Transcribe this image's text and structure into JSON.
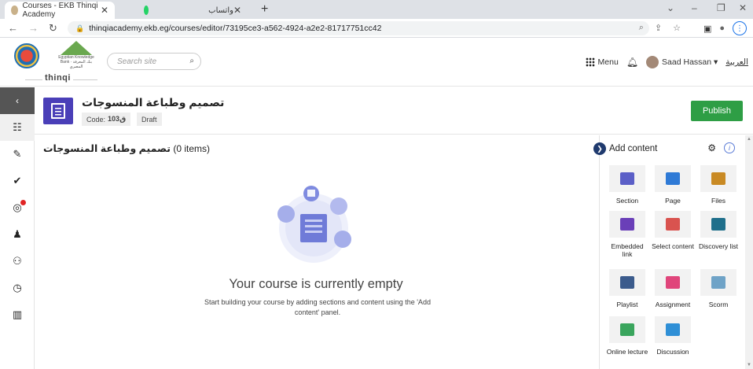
{
  "browser": {
    "tabs": [
      {
        "title": "Courses - EKB Thinqi Academy",
        "active": true
      },
      {
        "title": "واتساب",
        "active": false
      }
    ],
    "new_tab": "+",
    "url": "thinqiacademy.ekb.eg/courses/editor/73195ce3-a562-4924-a2e2-81717751cc42",
    "controls": {
      "minimize": "–",
      "restore": "❐",
      "close": "✕",
      "menu": "⌄"
    },
    "profile_initial": "⋮"
  },
  "header": {
    "search_placeholder": "Search site",
    "brand_small": "thinqi",
    "menu_label": "Menu",
    "user_name": "Saad Hassan",
    "user_caret": "▾",
    "language_link": "العربية",
    "ekb_caption": "Egyptian Knowledge Bank · بنك المعرفة المصري"
  },
  "sidebar": {
    "collapse": "‹",
    "items": [
      {
        "name": "course-outline",
        "glyph": "☷"
      },
      {
        "name": "edit",
        "glyph": "✎"
      },
      {
        "name": "assessments",
        "glyph": "✔"
      },
      {
        "name": "goals",
        "glyph": "◎"
      },
      {
        "name": "learners",
        "glyph": "♟"
      },
      {
        "name": "groups",
        "glyph": "⚇"
      },
      {
        "name": "history",
        "glyph": "◷"
      },
      {
        "name": "reports",
        "glyph": "▥"
      }
    ]
  },
  "course": {
    "title": "تصميم وطباعة المنسوجات",
    "code_label": "Code:",
    "code_value": "ق103",
    "status": "Draft",
    "publish_label": "Publish"
  },
  "main": {
    "section_title": "تصميم وطباعة المنسوجات",
    "item_count": "(0 items)",
    "empty_title": "Your course is currently empty",
    "empty_desc": "Start building your course by adding sections and content using the 'Add content' panel."
  },
  "add_content": {
    "title": "Add content",
    "info": "i",
    "tiles": [
      {
        "label": "Section",
        "icon": "section-icon",
        "color": "#5b5fc7"
      },
      {
        "label": "Page",
        "icon": "page-icon",
        "color": "#2f7ad6"
      },
      {
        "label": "Files",
        "icon": "files-icon",
        "color": "#c98a24"
      },
      {
        "label": "Embedded link",
        "icon": "link-icon",
        "color": "#6a3fb8"
      },
      {
        "label": "Select content",
        "icon": "select-content-icon",
        "color": "#d9534f"
      },
      {
        "label": "Discovery list",
        "icon": "discovery-icon",
        "color": "#1f6f8b"
      },
      {
        "label": "Playlist",
        "icon": "playlist-icon",
        "color": "#3b5b8c"
      },
      {
        "label": "Assignment",
        "icon": "assignment-icon",
        "color": "#e0457b"
      },
      {
        "label": "Scorm",
        "icon": "scorm-icon",
        "color": "#6fa3c7"
      },
      {
        "label": "Online lecture",
        "icon": "lecture-icon",
        "color": "#3aa55d"
      },
      {
        "label": "Discussion",
        "icon": "discussion-icon",
        "color": "#2f8fd6"
      }
    ]
  }
}
